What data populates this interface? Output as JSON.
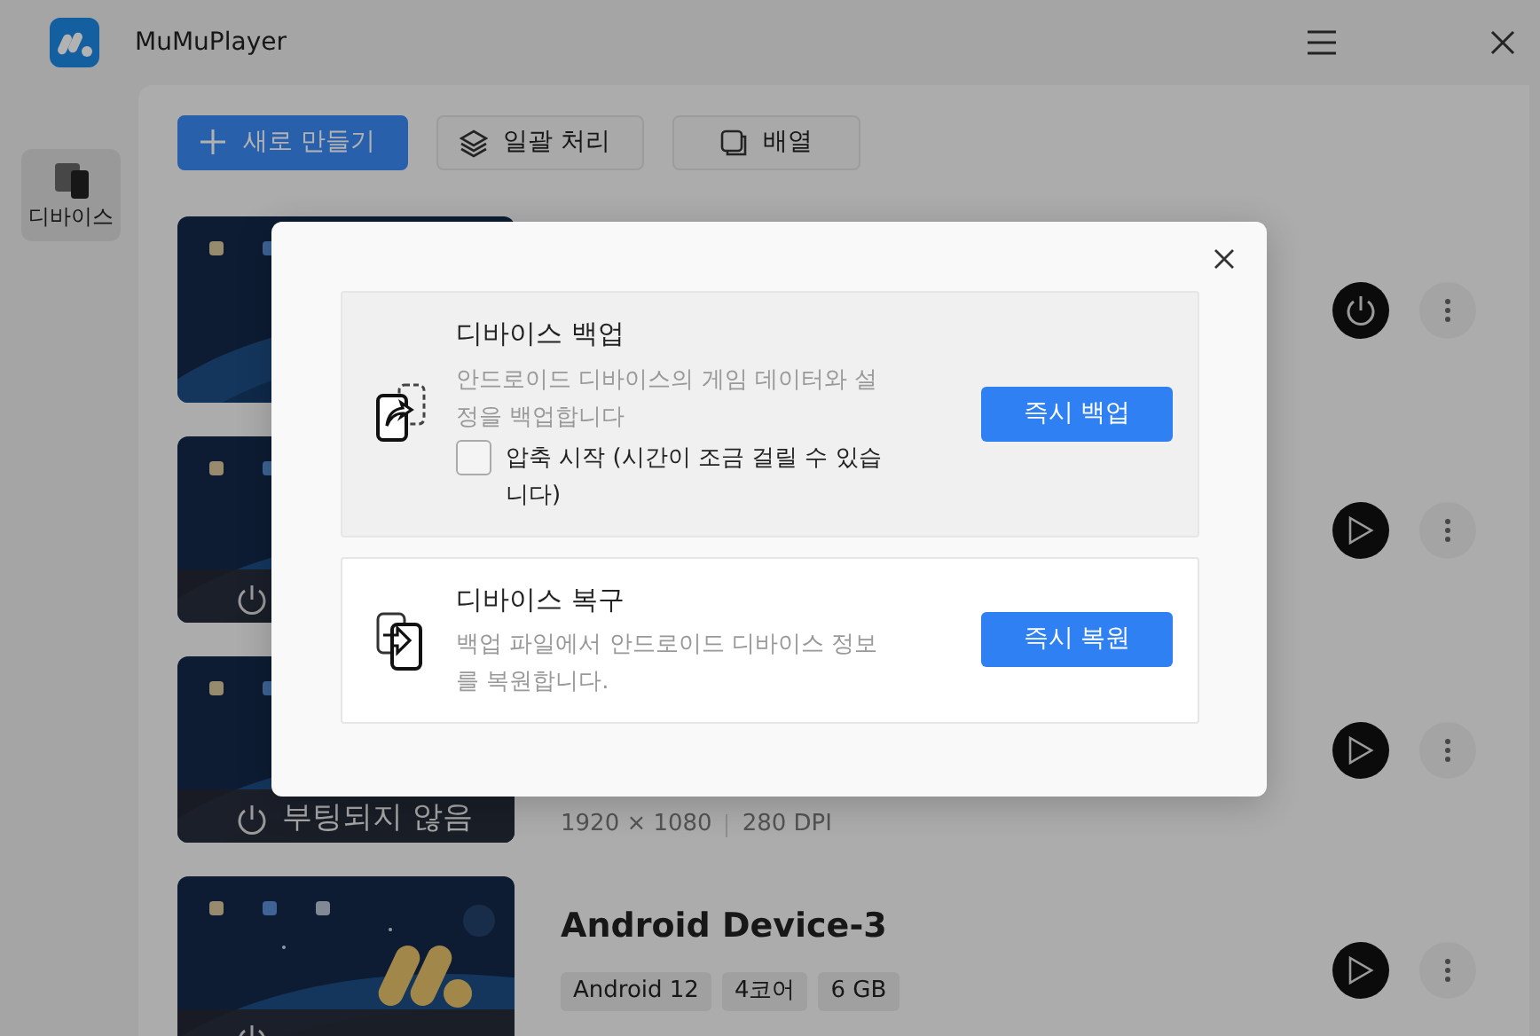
{
  "window": {
    "title": "MuMuPlayer"
  },
  "sidebar": {
    "items": [
      {
        "label": "디바이스",
        "selected": true
      }
    ]
  },
  "toolbar": {
    "buttons": [
      {
        "label": "새로 만들기",
        "kind": "primary"
      },
      {
        "label": "일괄 처리",
        "kind": "batch"
      },
      {
        "label": "배열",
        "kind": "arrange"
      }
    ]
  },
  "devices": [
    {
      "running": true,
      "boot_overlay": false
    },
    {
      "running": false,
      "boot_overlay": true
    },
    {
      "running": false,
      "boot_overlay": true,
      "status": "부팅되지 않음",
      "resolution": "1920 × 1080",
      "dpi": "280 DPI"
    },
    {
      "running": false,
      "boot_overlay": true,
      "name": "Android Device-3",
      "tags": [
        "Android 12",
        "4코어",
        "6 GB"
      ]
    }
  ],
  "dialog": {
    "sections": [
      {
        "kind": "backup",
        "title": "디바이스 백업",
        "description": "안드로이드 디바이스의 게임 데이터와 설정을 백업합니다",
        "option": {
          "label": "압축 시작 (시간이 조금 걸릴 수 있습니다)",
          "checked": false
        },
        "button": "즉시 백업",
        "hovered": true
      },
      {
        "kind": "restore",
        "title": "디바이스 복구",
        "description": "백업 파일에서 안드로이드 디바이스 정보를 복원합니다.",
        "button": "즉시 복원",
        "hovered": false
      }
    ]
  }
}
